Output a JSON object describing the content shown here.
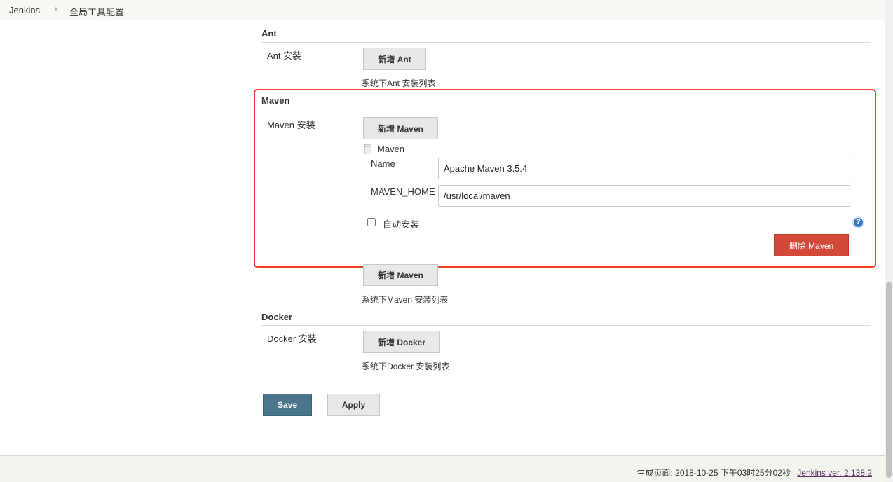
{
  "breadcrumb": [
    "Jenkins",
    "全局工具配置"
  ],
  "ant": {
    "title": "Ant",
    "label": "Ant 安装",
    "add_button": "新增 Ant",
    "description": "系统下Ant 安装列表"
  },
  "maven": {
    "title": "Maven",
    "label": "Maven 安装",
    "add_button": "新增 Maven",
    "installation": {
      "header": "Maven",
      "name_label": "Name",
      "name_value": "Apache Maven 3.5.4",
      "home_label": "MAVEN_HOME",
      "home_value": "/usr/local/maven",
      "auto_install_label": "自动安装",
      "auto_install_checked": false,
      "delete_button": "删除 Maven",
      "help_icon": "?"
    },
    "add_button_bottom": "新增 Maven",
    "description": "系统下Maven 安装列表"
  },
  "docker": {
    "title": "Docker",
    "label": "Docker 安装",
    "add_button": "新增 Docker",
    "description": "系统下Docker 安装列表"
  },
  "actions": {
    "save": "Save",
    "apply": "Apply"
  },
  "footer": {
    "generated": "生成页面: 2018-10-25 下午03时25分02秒",
    "version_link": "Jenkins ver. 2.138.2"
  },
  "colors": {
    "highlight": "#e8402c",
    "save_button": "#4b758b",
    "delete_button": "#d24939",
    "help_icon": "#3a78c2"
  }
}
